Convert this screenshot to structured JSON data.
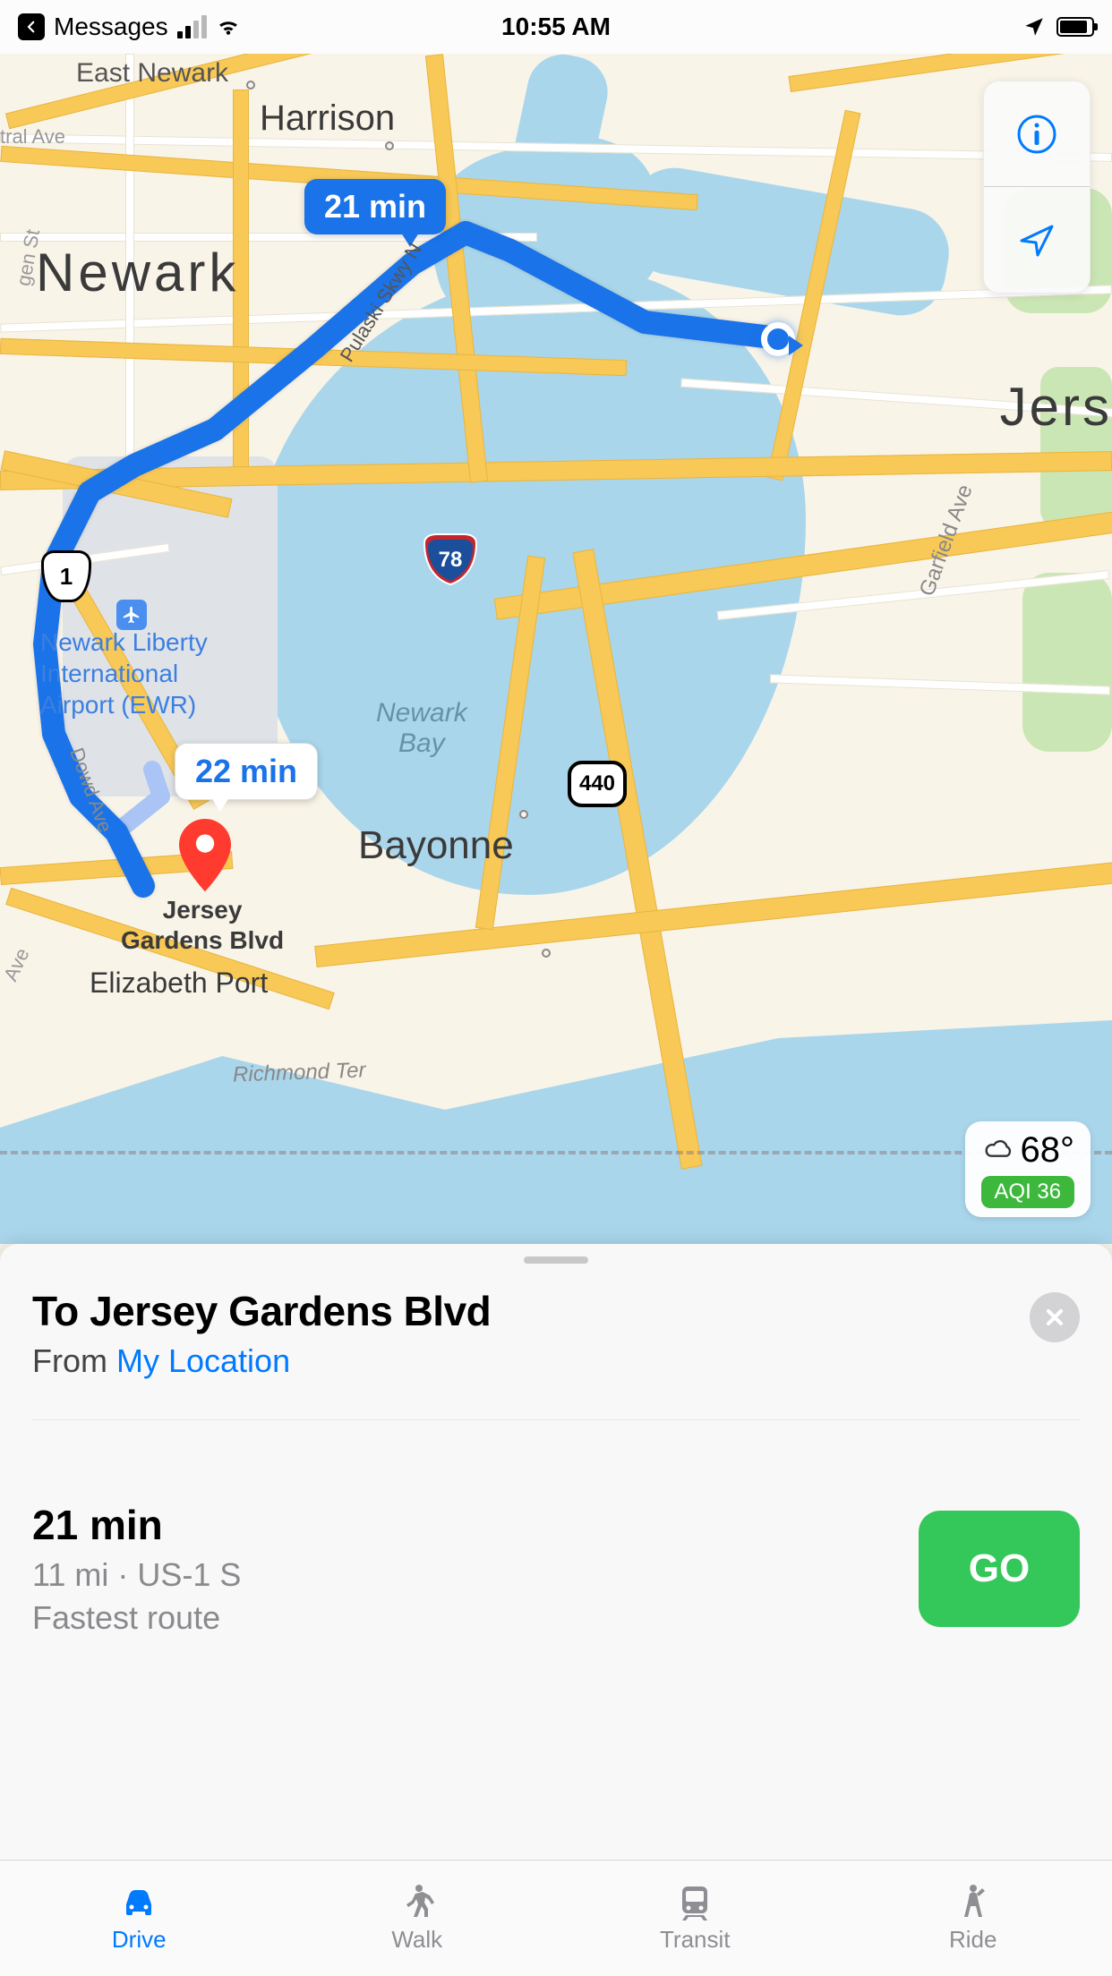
{
  "status_bar": {
    "back_app": "Messages",
    "time": "10:55 AM"
  },
  "map": {
    "route_primary_time": "21 min",
    "route_alt_time": "22 min",
    "labels": {
      "newark": "Newark",
      "harrison": "Harrison",
      "east_newark": "East Newark",
      "jersey_city": "Jers",
      "bayonne": "Bayonne",
      "newark_bay": "Newark\nBay",
      "elizabeth_port": "Elizabeth Port",
      "jersey_gardens": "Jersey\nGardens Blvd",
      "airport": "Newark Liberty\nInternational\nAirport (EWR)",
      "richmond": "Richmond Ter",
      "garfield": "Garfield Ave",
      "pulaski": "Pulaski Skwy N",
      "dowd": "Dowd Ave",
      "tral": "tral Ave",
      "gen": "gen St",
      "ave": "Ave"
    },
    "shields": {
      "us1": "1",
      "i78": "78",
      "r440": "440"
    },
    "weather": {
      "temp": "68°",
      "aqi": "AQI 36"
    }
  },
  "sheet": {
    "title": "To Jersey Gardens Blvd",
    "from_prefix": "From ",
    "from_link": "My Location",
    "route": {
      "time": "21 min",
      "distance_via": "11 mi · US-1 S",
      "note": "Fastest route"
    },
    "go_label": "GO"
  },
  "tabs": {
    "drive": "Drive",
    "walk": "Walk",
    "transit": "Transit",
    "ride": "Ride"
  }
}
